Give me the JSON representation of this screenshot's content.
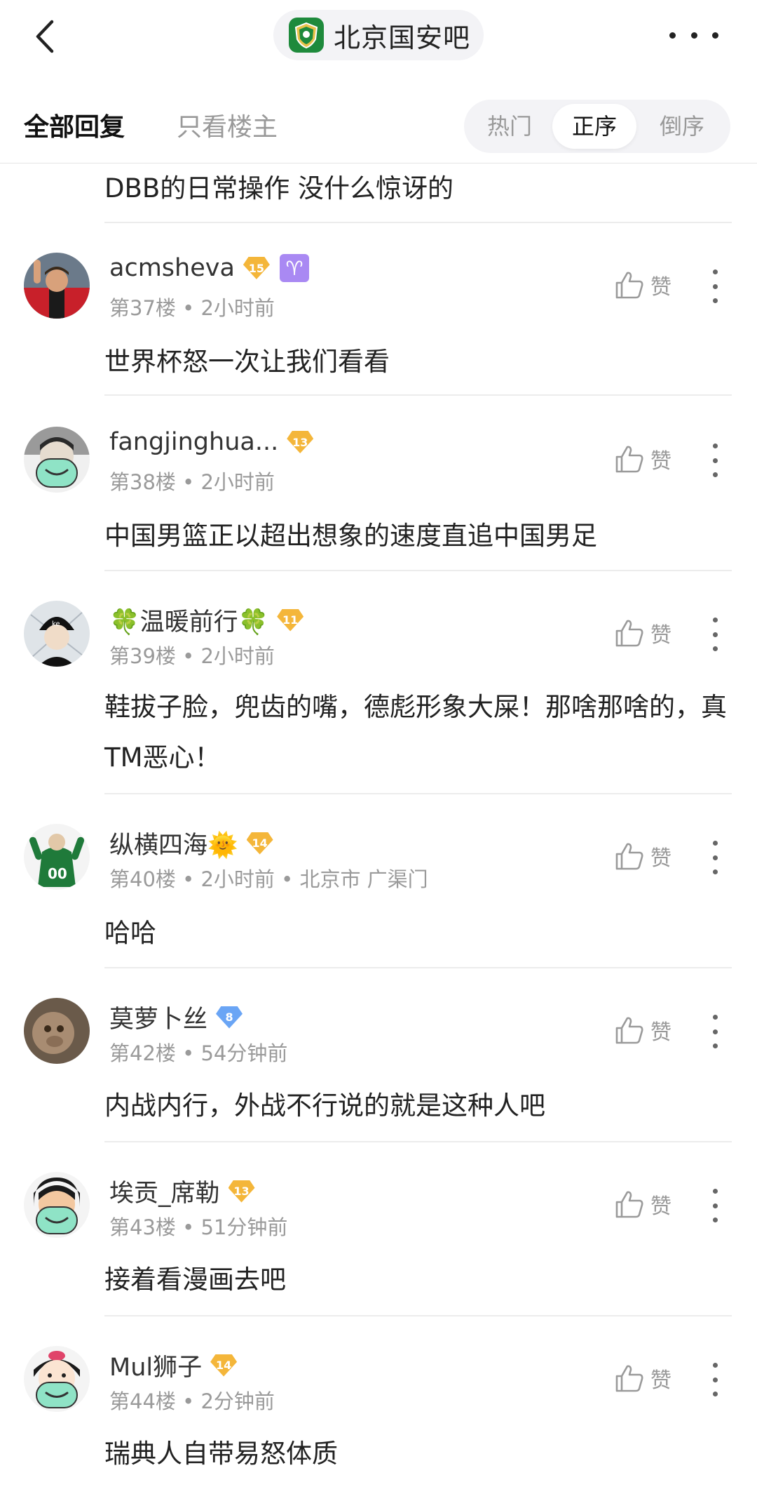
{
  "header": {
    "forum_name": "北京国安吧"
  },
  "filters": {
    "all_replies": "全部回复",
    "owner_only": "只看楼主",
    "sort": {
      "hot": "热门",
      "asc": "正序",
      "desc": "倒序",
      "selected": "正序"
    }
  },
  "partial_reply": "DBB的日常操作 没什么惊讶的",
  "like_label": "赞",
  "posts": [
    {
      "user": "acmsheva",
      "level": "15",
      "badge": "♈",
      "floor": "第37楼",
      "time": "2小时前",
      "location": "",
      "text": "世界杯怒一次让我们看看"
    },
    {
      "user": "fangjinghua...",
      "level": "13",
      "floor": "第38楼",
      "time": "2小时前",
      "location": "",
      "text": "中国男篮正以超出想象的速度直追中国男足"
    },
    {
      "user": "🍀温暖前行🍀",
      "level": "11",
      "floor": "第39楼",
      "time": "2小时前",
      "location": "",
      "text": "鞋拔子脸，兜齿的嘴，德彪形象大屎！那啥那啥的，真TM恶心！"
    },
    {
      "user": "纵横四海🌞",
      "level": "14",
      "floor": "第40楼",
      "time": "2小时前",
      "location": "北京市 广渠门",
      "text": "哈哈"
    },
    {
      "user": "莫萝卜丝",
      "level": "8",
      "floor": "第42楼",
      "time": "54分钟前",
      "location": "",
      "text": "内战内行，外战不行说的就是这种人吧"
    },
    {
      "user": "埃贡_席勒",
      "level": "13",
      "floor": "第43楼",
      "time": "51分钟前",
      "location": "",
      "text": "接着看漫画去吧"
    },
    {
      "user": "Mul狮子",
      "level": "14",
      "floor": "第44楼",
      "time": "2分钟前",
      "location": "",
      "text": "瑞典人自带易怒体质"
    }
  ],
  "colors": {
    "level_gold": "#f4b63a",
    "level_blue": "#6aa5f5",
    "forum_green": "#1e8a3c"
  }
}
